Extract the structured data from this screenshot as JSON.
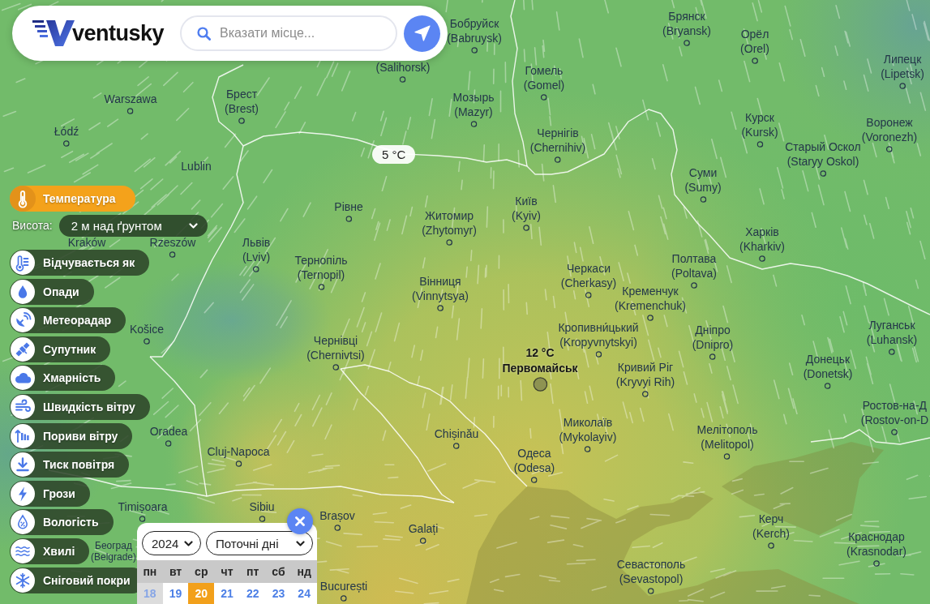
{
  "header": {
    "logo": "ventusky",
    "search": {
      "placeholder": "Вказати місце..."
    }
  },
  "layers_panel": {
    "height": {
      "label": "Висота:",
      "value": "2 м над ґрунтом"
    },
    "layers": [
      {
        "label": "Температура",
        "kind": "temperature",
        "selected": true
      },
      {
        "label": "Відчувається як",
        "kind": "feels",
        "selected": false
      },
      {
        "label": "Опади",
        "kind": "precipitation",
        "selected": false
      },
      {
        "label": "Метеорадар",
        "kind": "radar",
        "selected": false
      },
      {
        "label": "Супутник",
        "kind": "satellite",
        "selected": false
      },
      {
        "label": "Хмарність",
        "kind": "clouds",
        "selected": false
      },
      {
        "label": "Швидкість вітру",
        "kind": "wind",
        "selected": false
      },
      {
        "label": "Пориви вітру",
        "kind": "gusts",
        "selected": false
      },
      {
        "label": "Тиск повітря",
        "kind": "pressure",
        "selected": false
      },
      {
        "label": "Грози",
        "kind": "storms",
        "selected": false
      },
      {
        "label": "Вологість",
        "kind": "humidity",
        "selected": false
      },
      {
        "label": "Хвилі",
        "kind": "waves",
        "selected": false
      },
      {
        "label": "Сніговий покри",
        "kind": "snow",
        "selected": false
      }
    ]
  },
  "map": {
    "temperature_label": "5 °C",
    "selected_place": {
      "temperature": "12 °C",
      "name": "Первомайськ"
    },
    "cities": [
      {
        "name": "Брянск",
        "translit": "(Bryansk)",
        "marker": true
      },
      {
        "name": "Бобруйск",
        "translit": "(Babruysk)",
        "marker": true
      },
      {
        "name": "Орёл",
        "translit": "(Orel)",
        "marker": true
      },
      {
        "translit": "(Salihorsk)",
        "marker": true
      },
      {
        "name": "Липецк",
        "translit": "(Lipetsk)",
        "marker": true
      },
      {
        "name": "Гомель",
        "translit": "(Gomel)",
        "marker": true
      },
      {
        "name": "Warszawa",
        "marker": true
      },
      {
        "name": "Брест",
        "translit": "(Brest)",
        "marker": true
      },
      {
        "name": "Мозырь",
        "translit": "(Mazyr)",
        "marker": true
      },
      {
        "name": "Łódź",
        "marker": true
      },
      {
        "name": "Курск",
        "translit": "(Kursk)",
        "marker": true
      },
      {
        "name": "Воронеж",
        "translit": "(Voronezh)",
        "marker": true
      },
      {
        "name": "Чернігів",
        "translit": "(Chernihiv)",
        "marker": true
      },
      {
        "name": "Lublin",
        "marker": false
      },
      {
        "name": "Старый Оскол",
        "translit": "(Staryy Oskol)",
        "marker": true
      },
      {
        "name": "Суми",
        "translit": "(Sumy)",
        "marker": true
      },
      {
        "name": "Рівне",
        "marker": true
      },
      {
        "name": "Київ",
        "translit": "(Kyiv)",
        "marker": true
      },
      {
        "name": "Житомир",
        "translit": "(Zhytomyr)",
        "marker": true
      },
      {
        "name": "Kraków",
        "marker": false
      },
      {
        "name": "Rzeszów",
        "marker": true
      },
      {
        "name": "Харків",
        "translit": "(Kharkiv)",
        "marker": true
      },
      {
        "name": "Львів",
        "translit": "(Lviv)",
        "marker": true
      },
      {
        "name": "Тернопіль",
        "translit": "(Ternopil)",
        "marker": true
      },
      {
        "name": "Полтава",
        "translit": "(Poltava)",
        "marker": true
      },
      {
        "name": "Черкаси",
        "translit": "(Cherkasy)",
        "marker": true
      },
      {
        "name": "Вінниця",
        "translit": "(Vinnytsya)",
        "marker": true
      },
      {
        "name": "Кременчук",
        "translit": "(Kremenchuk)",
        "marker": true
      },
      {
        "name": "Košice",
        "marker": true
      },
      {
        "name": "Кропивни́цький",
        "translit": "(Kropyvnytskyi)",
        "marker": true
      },
      {
        "name": "Дніпро",
        "translit": "(Dnipro)",
        "marker": true
      },
      {
        "name": "Луганськ",
        "translit": "(Luhansk)",
        "marker": true
      },
      {
        "name": "Чернівці",
        "translit": "(Chernivtsi)",
        "marker": true
      },
      {
        "name": "Донецьк",
        "translit": "(Donetsk)",
        "marker": true
      },
      {
        "name": "Кривий Ріг",
        "translit": "(Kryvyi Rih)",
        "marker": true
      },
      {
        "name": "Ростов-на-Д",
        "translit": "(Rostov-on-D",
        "marker": true
      },
      {
        "name": "Oradea",
        "marker": true
      },
      {
        "name": "Chișinău",
        "marker": true
      },
      {
        "name": "Миколаїв",
        "translit": "(Mykolayiv)",
        "marker": true
      },
      {
        "name": "Мелітополь",
        "translit": "(Melitopol)",
        "marker": true
      },
      {
        "name": "Cluj-Napoca",
        "marker": true
      },
      {
        "name": "Одеса",
        "translit": "(Odesa)",
        "marker": true
      },
      {
        "name": "Timișoara",
        "marker": true
      },
      {
        "name": "Sibiu",
        "marker": true
      },
      {
        "name": "Brașov",
        "marker": true
      },
      {
        "name": "Galați",
        "marker": true
      },
      {
        "name": "Керч",
        "translit": "(Kerch)",
        "marker": true
      },
      {
        "name": "Београд",
        "translit": "(Belgrade)",
        "marker": false
      },
      {
        "name": "Краснодар",
        "translit": "(Krasnodar)",
        "marker": true
      },
      {
        "name": "Севастополь",
        "translit": "(Sevastopol)",
        "marker": true
      },
      {
        "name": "București",
        "marker": true
      }
    ]
  },
  "calendar": {
    "year": "2024",
    "period": "Поточні дні",
    "weekdays": [
      "пн",
      "вт",
      "ср",
      "чт",
      "пт",
      "сб",
      "нд"
    ],
    "days": [
      {
        "label": "18",
        "selected": false,
        "disabled": true
      },
      {
        "label": "19",
        "selected": false,
        "disabled": false
      },
      {
        "label": "20",
        "selected": true,
        "disabled": false
      },
      {
        "label": "21",
        "selected": false,
        "disabled": false
      },
      {
        "label": "22",
        "selected": false,
        "disabled": false
      },
      {
        "label": "23",
        "selected": false,
        "disabled": false
      },
      {
        "label": "24",
        "selected": false,
        "disabled": false
      }
    ]
  }
}
